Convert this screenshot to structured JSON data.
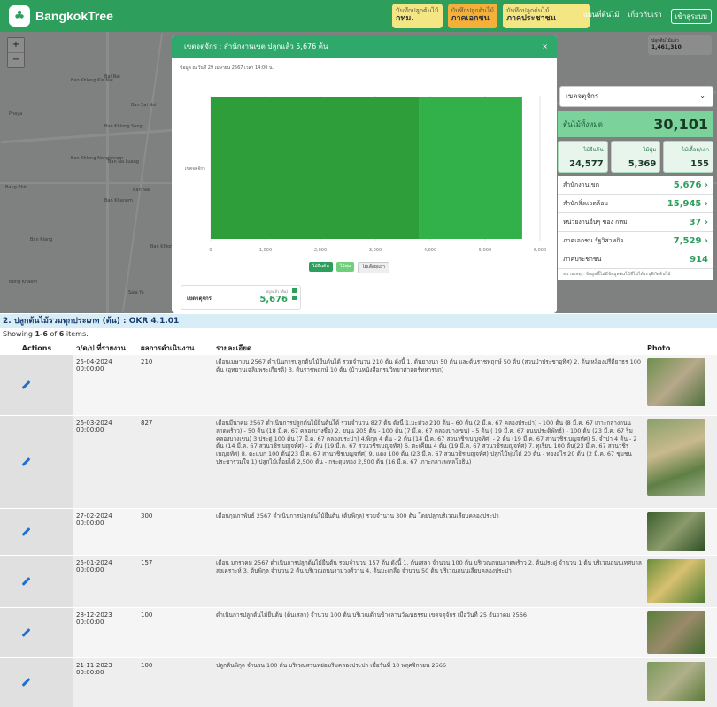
{
  "app": {
    "brand": "BangkokTree"
  },
  "topbar": {
    "stats": [
      {
        "label": "บันทึกปลูกต้นไม้",
        "value": "กทม."
      },
      {
        "label": "บันทึกปลูกต้นไม้",
        "value": "ภาคเอกชน"
      },
      {
        "label": "บันทึกปลูกต้นไม้",
        "value": "ภาคประชาชน"
      }
    ],
    "links": [
      "แผนที่ต้นไม้",
      "เกี่ยวกับเรา",
      "เข้าสู่ระบบ"
    ]
  },
  "map": {
    "labels": [
      "Ban Khlong Kia Nai",
      "Bai Nai",
      "Ban Sai Noi",
      "Phaya",
      "Ban Khlong Song",
      "Ban Khlong Nangkhram",
      "Ban Na Luang",
      "Ban Nai",
      "Ban Khanom",
      "Bang Phin",
      "Ban Klang",
      "Sala Ya",
      "Nong Khaem",
      "Ban Khlong Sip"
    ],
    "mini_badge": {
      "label": "ปลูกต้นไม้แล้ว",
      "value": "1,461,310"
    }
  },
  "modal": {
    "title": "เขตจตุจักร : สำนักงานเขต ปลูกแล้ว 5,676 ต้น",
    "close": "×",
    "updated": "ข้อมูล ณ วันที่ 29 เมษายน 2567 เวลา 14:00 น.",
    "legend": [
      "ไม้ยืนต้น",
      "ไม้พุ่ม",
      "ไม้เลื้อย/เถา"
    ],
    "mini": {
      "label": "เขตจตุจักร",
      "caption": "ปลูกแล้ว (ต้น)",
      "value": "5,676"
    }
  },
  "chart_data": {
    "type": "bar",
    "orientation": "horizontal",
    "stacked": true,
    "categories": [
      "เขตจตุจักร"
    ],
    "series": [
      {
        "name": "ไม้ยืนต้น",
        "values": [
          3800
        ],
        "color": "#2e9e3a"
      },
      {
        "name": "ไม้พุ่ม",
        "values": [
          1876
        ],
        "color": "#32b04a"
      }
    ],
    "xlim": [
      0,
      6000
    ],
    "xticks": [
      "0",
      "1,000",
      "2,000",
      "3,000",
      "4,000",
      "5,000",
      "6,000"
    ],
    "grid": true
  },
  "side": {
    "select": "เขตจตุจักร",
    "total_label": "ต้นไม้ทั้งหมด",
    "total": "30,101",
    "types": [
      {
        "label": "ไม้ยืนต้น",
        "value": "24,577"
      },
      {
        "label": "ไม้พุ่ม",
        "value": "5,369"
      },
      {
        "label": "ไม้เลื้อย/เถา",
        "value": "155"
      }
    ],
    "agencies": [
      {
        "label": "สำนักงานเขต",
        "value": "5,676 ›"
      },
      {
        "label": "สำนักสิ่งแวดล้อม",
        "value": "15,945 ›"
      },
      {
        "label": "หน่วยงานอื่นๆ ของ กทม.",
        "value": "37 ›"
      },
      {
        "label": "ภาคเอกชน รัฐวิสาหกิจ",
        "value": "7,529 ›"
      },
      {
        "label": "ภาคประชาชน",
        "value": "914"
      }
    ],
    "note": "หมายเหตุ : ข้อมูลนี้ไม่มีข้อมูลต้นไม้ที่ไม่ได้ระบุพิกัดต้นไม้"
  },
  "section": {
    "title": "2. ปลูกต้นไม้รวมทุกประเภท (ต้น) : OKR 4.1.01",
    "summary_prefix": "Showing ",
    "summary_range": "1-6",
    "summary_mid": " of ",
    "summary_total": "6",
    "summary_suffix": " items."
  },
  "table": {
    "headers": [
      "Actions",
      "ว/ด/ป ที่รายงาน",
      "ผลการดำเนินงาน",
      "รายละเอียด",
      "Photo"
    ],
    "rows": [
      {
        "date": "25-04-2024 00:00:00",
        "result": "210",
        "detail": "เดือนเมษายน 2567 ดำเนินการปลูกต้นไม้ยืนต้นได้ รวมจำนวน 210 ต้น ดังนี้ 1. ต้นยางนา 50 ต้น และต้นราชพฤกษ์ 50 ต้น (สวนป่าประชาอุทิศ) 2. ต้นเหลืองปรีดียาธร 100 ต้น (อุทยานเฉลิมพระเกียรติ) 3. ต้นราชพฤกษ์ 10 ต้น (บ้านหนังสือกรมวิทยาศาสตร์ทหารบก)"
      },
      {
        "date": "26-03-2024 00:00:00",
        "result": "827",
        "detail": "เดือนมีนาคม 2567 ดำเนินการปลูกต้นไม้ยืนต้นได้ รวมจำนวน 827 ต้น ดังนี้ 1.มะม่วง 210 ต้น - 60 ต้น (2 มี.ค. 67 คลองประปา) - 100 ต้น (8 มี.ค. 67 เกาะกลางถนนลาดพร้าว) - 50 ต้น (18 มี.ค. 67 คลองบางซื่อ) 2. ขนุน 205 ต้น - 100 ต้น (7 มี.ค. 67 คลองบางเขน) - 5 ต้น ( 19 มี.ค. 67 ถนนประดิพัทธ์) - 100 ต้น (23 มี.ค. 67 ริมคลองบางเขน) 3.ประดู่ 100 ต้น (7 มี.ค. 67 คลองประปา) 4.พิกุล 4 ต้น - 2 ต้น (14 มี.ค. 67 สวนวชิรเบญจทัศ) - 2 ต้น (19 มี.ค. 67 สวนวชิรเบญจทัศ) 5. จำปา 4 ต้น - 2 ต้น (14 มี.ค. 67 สวนวชิรเบญจทัศ) - 2 ต้น (19 มี.ค. 67 สวนวชิรเบญจทัศ) 6. ตะเคียน 4 ต้น (19 มี.ค. 67 สวนวชิรเบญจทัศ) 7. ทุเรียน 100 ต้น(23 มี.ค. 67 สวนวชิรเบญจทัศ) 8. ตะแบก 100 ต้น(23 มี.ค. 67 สวนวชิรเบญจทัศ) 9. แดง 100 ต้น (23 มี.ค. 67 สวนวชิรเบญจทัศ) ปลูกไม้พุ่มได้ 20 ต้น - ทองอุไร 20 ต้น (2 มี.ค. 67 ชุมชนประชาร่วมใจ 1) ปลูกไม้เลื้อยได้ 2,500 ต้น - กระดุมทอง 2,500 ต้น (16 มี.ค. 67 เกาะกลางพหลโยธิน)"
      },
      {
        "date": "27-02-2024 00:00:00",
        "result": "300",
        "detail": "เดือนกุมภาพันธ์ 2567 ดำเนินการปลูกต้นไม้ยืนต้น (ต้นพิกุล) รวมจำนวน 300 ต้น โดยปลูกบริเวณเลียบคลองประปา"
      },
      {
        "date": "25-01-2024 00:00:00",
        "result": "157",
        "detail": "เดือน มกราคม 2567 ดำเนินการปลูกต้นไม้ยืนต้น รวมจำนวน 157 ต้น ดังนี้ 1. ต้นเสลา จำนวน 100 ต้น บริเวณถนนลาดพร้าว 2. ต้นประดู่ จำนวน 1 ต้น บริเวณถนนเทศบาลสงเคราะห์ 3. ต้นพิกุล จำนวน 2 ต้น บริเวณถนนงามวงศ์วาน 4. ต้นมะเกลือ จำนวน 50 ต้น บริเวณถนนเลียบคลองประปา"
      },
      {
        "date": "28-12-2023 00:00:00",
        "result": "100",
        "detail": "ดำเนินการปลูกต้นไม้ยืนต้น (ต้นเสลา) จำนวน 100 ต้น บริเวณด้านข้างลานวัฒนธรรม เขตจตุจักร เมื่อวันที่ 25 ธันวาคม 2566"
      },
      {
        "date": "21-11-2023 00:00:00",
        "result": "100",
        "detail": "ปลูกต้นพิกุล จำนวน 100 ต้น บริเวณสวนหย่อมริมคลองประปา เมื่อวันที่ 10 พฤศจิกายน 2566"
      }
    ]
  }
}
